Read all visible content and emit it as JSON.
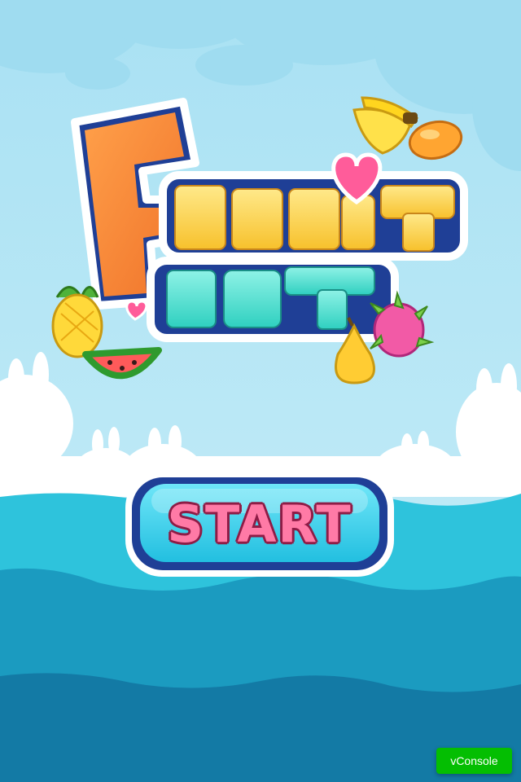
{
  "game": {
    "logo_line1": "FRUIT",
    "logo_line2": "FEST",
    "start_label": "START"
  },
  "debug": {
    "vconsole_label": "vConsole"
  },
  "colors": {
    "sky": "#bfeaf6",
    "cloud": "#9fdcf0",
    "near_water": "#2ec3dc",
    "mid_water": "#1b9bc0",
    "deep_water": "#137aa5",
    "button_fill": "#3dd4ef",
    "button_border": "#1f3f96",
    "start_text": "#ff7aa6",
    "vconsole_bg": "#04be02"
  },
  "icons": [
    "banana-icon",
    "mango-icon",
    "heart-icon",
    "pineapple-icon",
    "watermelon-icon",
    "pear-icon",
    "dragonfruit-icon",
    "bunny-cloud-icon"
  ]
}
